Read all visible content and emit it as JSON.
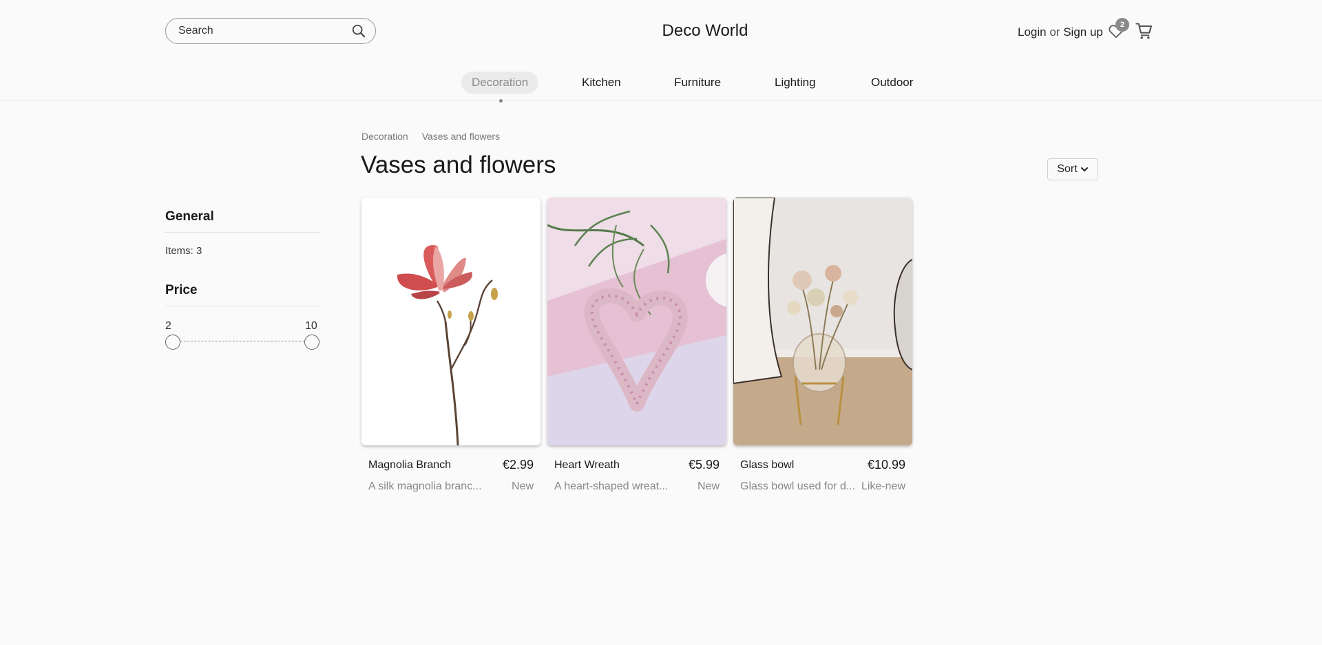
{
  "header": {
    "search_placeholder": "Search",
    "brand": "Deco World",
    "login_label": "Login",
    "or_label": "or",
    "signup_label": "Sign up",
    "wishlist_count": "2"
  },
  "categories": [
    {
      "label": "Decoration",
      "active": true
    },
    {
      "label": "Kitchen",
      "active": false
    },
    {
      "label": "Furniture",
      "active": false
    },
    {
      "label": "Lighting",
      "active": false
    },
    {
      "label": "Outdoor",
      "active": false
    }
  ],
  "breadcrumb": [
    "Decoration",
    "Vases and flowers"
  ],
  "page_title": "Vases and flowers",
  "sort_label": "Sort",
  "sidebar": {
    "general_heading": "General",
    "items_count": "Items: 3",
    "price_heading": "Price",
    "price_min": "2",
    "price_max": "10"
  },
  "products": [
    {
      "name": "Magnolia Branch",
      "price": "€2.99",
      "description": "A silk magnolia branc...",
      "condition": "New"
    },
    {
      "name": "Heart Wreath",
      "price": "€5.99",
      "description": "A heart-shaped wreat...",
      "condition": "New"
    },
    {
      "name": "Glass bowl",
      "price": "€10.99",
      "description": "Glass bowl used for d...",
      "condition": "Like-new"
    }
  ],
  "colors": {
    "background": "#fafafa",
    "active_tab_bg": "#ebebeb",
    "muted_text": "#888888",
    "badge": "#8a8a8a"
  }
}
